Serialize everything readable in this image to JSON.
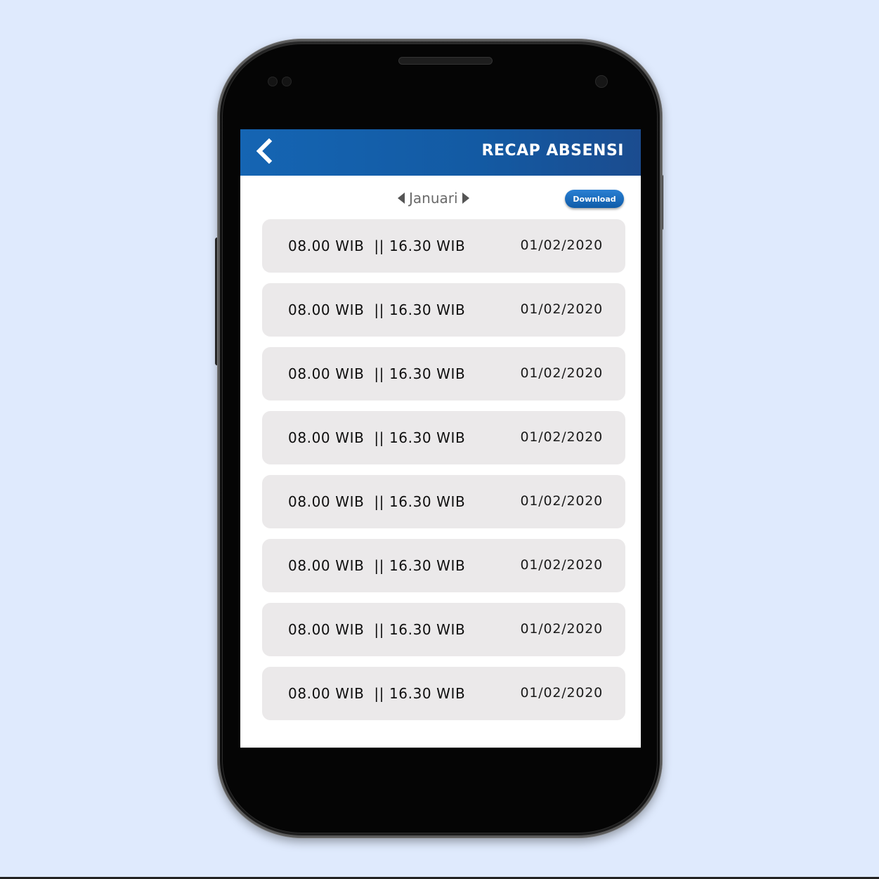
{
  "appbar": {
    "title": "RECAP ABSENSI",
    "back_icon": "chevron-left-icon",
    "color_start": "#1565b3",
    "color_end": "#1b4c8f"
  },
  "filter": {
    "month": "Januari",
    "download_label": "Download"
  },
  "records": [
    {
      "times": "08.00 WIB  || 16.30 WIB",
      "date": "01/02/2020"
    },
    {
      "times": "08.00 WIB  || 16.30 WIB",
      "date": "01/02/2020"
    },
    {
      "times": "08.00 WIB  || 16.30 WIB",
      "date": "01/02/2020"
    },
    {
      "times": "08.00 WIB  || 16.30 WIB",
      "date": "01/02/2020"
    },
    {
      "times": "08.00 WIB  || 16.30 WIB",
      "date": "01/02/2020"
    },
    {
      "times": "08.00 WIB  || 16.30 WIB",
      "date": "01/02/2020"
    },
    {
      "times": "08.00 WIB  || 16.30 WIB",
      "date": "01/02/2020"
    },
    {
      "times": "08.00 WIB  || 16.30 WIB",
      "date": "01/02/2020"
    }
  ]
}
